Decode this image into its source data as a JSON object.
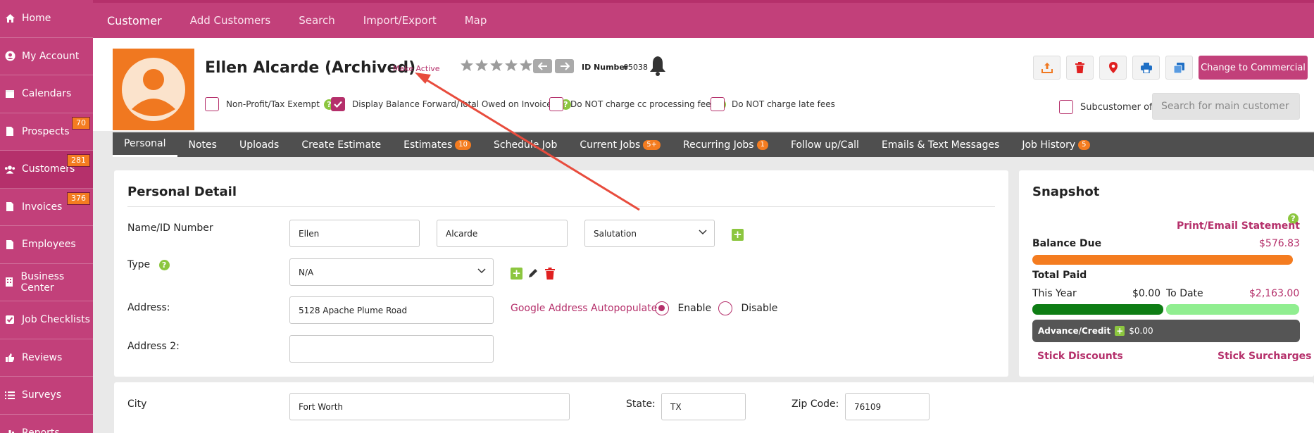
{
  "sidebar": {
    "items": [
      {
        "label": "Home",
        "icon": "home-icon",
        "badge": ""
      },
      {
        "label": "My Account",
        "icon": "user-circle-icon",
        "badge": ""
      },
      {
        "label": "Calendars",
        "icon": "calendar-icon",
        "badge": ""
      },
      {
        "label": "Prospects",
        "icon": "document-icon",
        "badge": "70"
      },
      {
        "label": "Customers",
        "icon": "users-icon",
        "badge": "281"
      },
      {
        "label": "Invoices",
        "icon": "document-icon",
        "badge": "376"
      },
      {
        "label": "Employees",
        "icon": "document-icon",
        "badge": ""
      },
      {
        "label": "Business Center",
        "icon": "building-icon",
        "badge": ""
      },
      {
        "label": "Job Checklists",
        "icon": "checkbox-icon",
        "badge": ""
      },
      {
        "label": "Reviews",
        "icon": "thumbs-up-icon",
        "badge": ""
      },
      {
        "label": "Surveys",
        "icon": "list-icon",
        "badge": ""
      },
      {
        "label": "Reports",
        "icon": "chart-icon",
        "badge": ""
      }
    ]
  },
  "topnav": {
    "items": [
      "Customer",
      "Add Customers",
      "Search",
      "Import/Export",
      "Map"
    ],
    "active": "Customer"
  },
  "header": {
    "name": "Ellen Alcarde (Archived)",
    "make_active": "Make Active",
    "id_label": "ID Number",
    "id_value": "65038",
    "rating_stars": 5,
    "change_button": "Change to Commercial",
    "checkboxes": [
      {
        "label": "Non-Profit/Tax Exempt",
        "checked": false
      },
      {
        "label": "Display Balance Forward/Total Owed on Invoices",
        "checked": true
      },
      {
        "label": "Do NOT charge cc processing fee",
        "checked": false
      },
      {
        "label": "Do NOT charge late fees",
        "checked": false
      }
    ],
    "subcustomer_label": "Subcustomer of:",
    "subcustomer_placeholder": "Search for main customer"
  },
  "tabs": [
    {
      "label": "Personal",
      "badge": ""
    },
    {
      "label": "Notes",
      "badge": ""
    },
    {
      "label": "Uploads",
      "badge": ""
    },
    {
      "label": "Create Estimate",
      "badge": ""
    },
    {
      "label": "Estimates",
      "badge": "10"
    },
    {
      "label": "Schedule Job",
      "badge": ""
    },
    {
      "label": "Current Jobs",
      "badge": "5+"
    },
    {
      "label": "Recurring Jobs",
      "badge": "1"
    },
    {
      "label": "Follow up/Call",
      "badge": ""
    },
    {
      "label": "Emails & Text Messages",
      "badge": ""
    },
    {
      "label": "Job History",
      "badge": "5"
    }
  ],
  "personal": {
    "title": "Personal Detail",
    "name_label": "Name/ID Number",
    "first_name": "Ellen",
    "last_name": "Alcarde",
    "salutation": "Salutation",
    "type_label": "Type",
    "type_value": "N/A",
    "address_label": "Address:",
    "address_value": "5128 Apache Plume Road",
    "autopop_label": "Google Address Autopopulate",
    "enable_label": "Enable",
    "disable_label": "Disable",
    "address2_label": "Address 2:",
    "address2_value": "",
    "city_label": "City",
    "city_value": "Fort Worth",
    "state_label": "State:",
    "state_value": "TX",
    "zip_label": "Zip Code:",
    "zip_value": "76109"
  },
  "snapshot": {
    "title": "Snapshot",
    "print_link": "Print/Email Statement",
    "balance_label": "Balance Due",
    "balance_value": "$576.83",
    "total_paid_label": "Total Paid",
    "this_year_label": "This Year",
    "this_year_value": "$0.00",
    "to_date_label": "To Date",
    "to_date_value": "$2,163.00",
    "advance_label": "Advance/Credit",
    "advance_value": "$0.00",
    "stick_discounts": "Stick Discounts",
    "stick_surcharges": "Stick Surcharges"
  },
  "colors": {
    "brand": "#c2407a",
    "accent_orange": "#f47c20",
    "green": "#8cc63f",
    "dark_green": "#0e7d14",
    "light_green": "#90ee90"
  }
}
